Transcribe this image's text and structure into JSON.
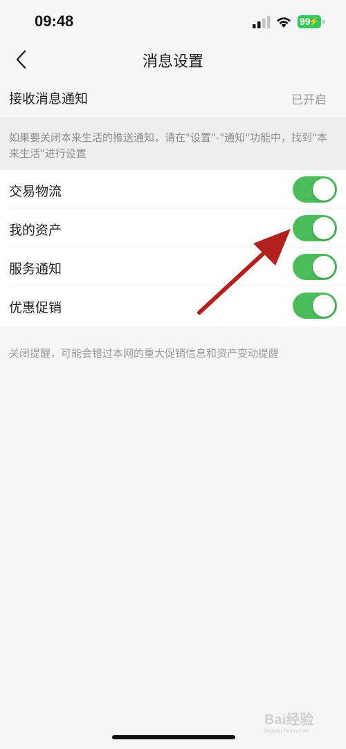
{
  "status_bar": {
    "time": "09:48",
    "battery": "99",
    "signal_icon": "cellular-signal-icon",
    "wifi_icon": "wifi-icon",
    "battery_color": "#34c759"
  },
  "nav": {
    "title": "消息设置",
    "back_icon": "chevron-left-icon"
  },
  "receive": {
    "label": "接收消息通知",
    "status": "已开启"
  },
  "hint": {
    "text": "如果要关闭本来生活的推送通知，请在\"设置\"-\"通知\"功能中，找到\"本来生活\"进行设置"
  },
  "toggles": [
    {
      "label": "交易物流",
      "on": true
    },
    {
      "label": "我的资产",
      "on": true
    },
    {
      "label": "服务通知",
      "on": true
    },
    {
      "label": "优惠促销",
      "on": true
    }
  ],
  "footer_note": "关闭提醒，可能会错过本网的重大促销信息和资产变动提醒",
  "colors": {
    "switch_on": "#4cbb5a",
    "annotation_arrow": "#b3201d"
  },
  "watermark": {
    "text": "Bai经验",
    "sub": "jingyan.baidu.com"
  }
}
